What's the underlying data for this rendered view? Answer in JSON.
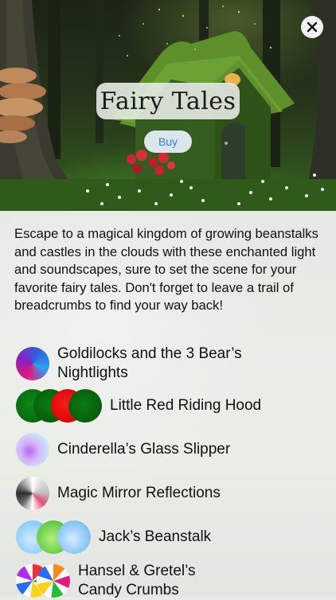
{
  "header": {
    "title": "Fairy Tales",
    "buy_label": "Buy",
    "close_icon": "close-icon"
  },
  "description": "Escape to a magical kingdom of growing beanstalks and castles in the clouds with these enchanted light and soundscapes, sure to set the scene for your favorite fairy tales. Don't forget to leave a trail of breadcrumbs to find your way back!",
  "items": [
    {
      "label": "Goldilocks and the 3 Bear’s Nightlights",
      "icon": "goldilocks-color-orb-icon"
    },
    {
      "label": "Little Red Riding Hood",
      "icon": "red-riding-hood-orbs-icon"
    },
    {
      "label": "Cinderella’s Glass Slipper",
      "icon": "glass-slipper-orb-icon"
    },
    {
      "label": "Magic Mirror Reflections",
      "icon": "magic-mirror-orb-icon"
    },
    {
      "label": "Jack’s Beanstalk",
      "icon": "beanstalk-orbs-icon"
    },
    {
      "label": "Hansel & Gretel’s Candy Crumbs",
      "icon": "candy-crumbs-orbs-icon"
    }
  ],
  "colors": {
    "accent": "#2f7de1",
    "text": "#111111"
  }
}
